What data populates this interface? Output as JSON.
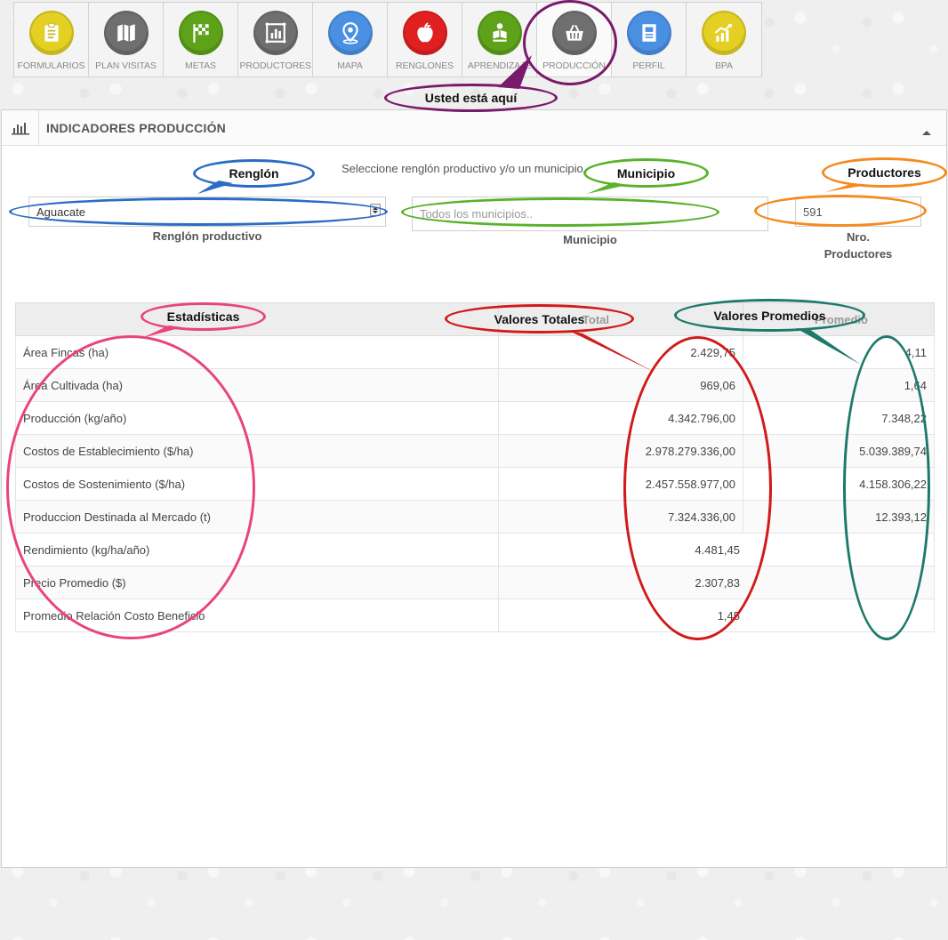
{
  "nav": {
    "items": [
      {
        "label": "FORMULARIOS",
        "icon": "clipboard-icon",
        "color": "#e3d023"
      },
      {
        "label": "PLAN VISITAS",
        "icon": "map-icon",
        "color": "#6f6f6f"
      },
      {
        "label": "METAS",
        "icon": "checkered-flag-icon",
        "color": "#5ea21a"
      },
      {
        "label": "PRODUCTORES",
        "icon": "chart-icon",
        "color": "#6f6f6f"
      },
      {
        "label": "MAPA",
        "icon": "location-pin-icon",
        "color": "#4a90e2"
      },
      {
        "label": "RENGLONES",
        "icon": "apple-icon",
        "color": "#e02020"
      },
      {
        "label": "APRENDIZAJE",
        "icon": "learning-icon",
        "color": "#5ea21a"
      },
      {
        "label": "PRODUCCIÓN",
        "icon": "basket-icon",
        "color": "#6f6f6f"
      },
      {
        "label": "PERFIL",
        "icon": "profile-icon",
        "color": "#4a90e2"
      },
      {
        "label": "BPA",
        "icon": "growth-chart-icon",
        "color": "#e3d023"
      }
    ],
    "active_index": 7
  },
  "annotations": {
    "here": "Usted está aquí",
    "renglon": "Renglón",
    "municipio": "Municipio",
    "productores": "Productores",
    "estadisticas": "Estadísticas",
    "totales": "Valores Totales",
    "promedios": "Valores Promedios"
  },
  "panel": {
    "title": "INDICADORES PRODUCCIÓN",
    "hint": "Seleccione renglón productivo y/o un municipio"
  },
  "filters": {
    "renglon_value": "Aguacate",
    "renglon_label": "Renglón productivo",
    "municipio_placeholder": "Todos los municipios..",
    "municipio_label": "Municipio",
    "productores_value": "591",
    "productores_label_1": "Nro.",
    "productores_label_2": "Productores"
  },
  "table": {
    "headers": {
      "name": "",
      "total": "Total",
      "promedio": "Promedio"
    },
    "rows": [
      {
        "name": "Área Fincas (ha)",
        "total": "2.429,75",
        "promedio": "4,11"
      },
      {
        "name": "Área Cultivada (ha)",
        "total": "969,06",
        "promedio": "1,64"
      },
      {
        "name": "Producción (kg/año)",
        "total": "4.342.796,00",
        "promedio": "7.348,22"
      },
      {
        "name": "Costos de Establecimiento ($/ha)",
        "total": "2.978.279.336,00",
        "promedio": "5.039.389,74"
      },
      {
        "name": "Costos de Sostenimiento ($/ha)",
        "total": "2.457.558.977,00",
        "promedio": "4.158.306,22"
      },
      {
        "name": "Produccion Destinada al Mercado (t)",
        "total": "7.324.336,00",
        "promedio": "12.393,12"
      },
      {
        "name": "Rendimiento (kg/ha/año)",
        "total": "4.481,45"
      },
      {
        "name": "Precio Promedio ($)",
        "total": "2.307,83"
      },
      {
        "name": "Promedio Relación Costo Beneficio",
        "total": "1,45"
      }
    ]
  }
}
